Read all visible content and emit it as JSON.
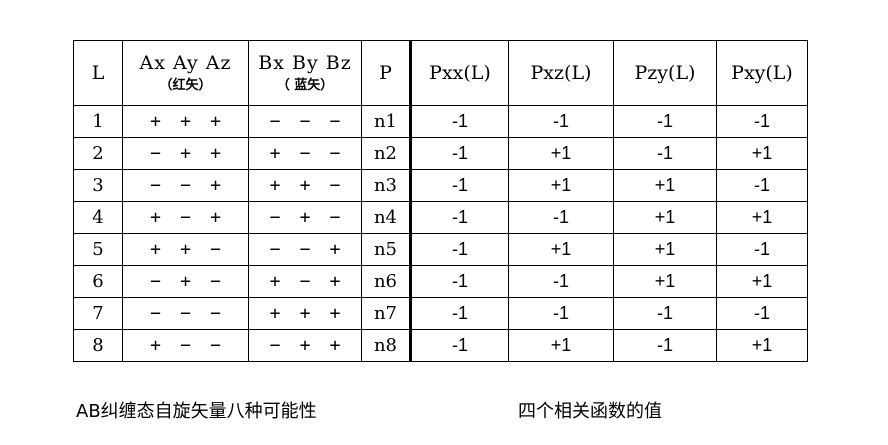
{
  "headers": {
    "L": "L",
    "A": "Ax Ay Az",
    "A_sub": "（红矢）",
    "B": "Bx By Bz",
    "B_sub": "（ 蓝矢）",
    "P": "P",
    "pxx": "Pxx(L)",
    "pxz": "Pxz(L)",
    "pzy": "Pzy(L)",
    "pxy": "Pxy(L)"
  },
  "rows": [
    {
      "l": "1",
      "a": [
        "+",
        "+",
        "+"
      ],
      "b": [
        "−",
        "−",
        "−"
      ],
      "p": "n1",
      "pxx": "-1",
      "pxz": "-1",
      "pzy": "-1",
      "pxy": "-1"
    },
    {
      "l": "2",
      "a": [
        "−",
        "+",
        "+"
      ],
      "b": [
        "+",
        "−",
        "−"
      ],
      "p": "n2",
      "pxx": "-1",
      "pxz": "+1",
      "pzy": "-1",
      "pxy": "+1"
    },
    {
      "l": "3",
      "a": [
        "−",
        "−",
        "+"
      ],
      "b": [
        "+",
        "+",
        "−"
      ],
      "p": "n3",
      "pxx": "-1",
      "pxz": "+1",
      "pzy": "+1",
      "pxy": "-1"
    },
    {
      "l": "4",
      "a": [
        "+",
        "−",
        "+"
      ],
      "b": [
        "−",
        "+",
        "−"
      ],
      "p": "n4",
      "pxx": "-1",
      "pxz": "-1",
      "pzy": "+1",
      "pxy": "+1"
    },
    {
      "l": "5",
      "a": [
        "+",
        "+",
        "−"
      ],
      "b": [
        "−",
        "−",
        "+"
      ],
      "p": "n5",
      "pxx": "-1",
      "pxz": "+1",
      "pzy": "+1",
      "pxy": "-1"
    },
    {
      "l": "6",
      "a": [
        "−",
        "+",
        "−"
      ],
      "b": [
        "+",
        "−",
        "+"
      ],
      "p": "n6",
      "pxx": "-1",
      "pxz": "-1",
      "pzy": "+1",
      "pxy": "+1"
    },
    {
      "l": "7",
      "a": [
        "−",
        "−",
        "−"
      ],
      "b": [
        "+",
        "+",
        "+"
      ],
      "p": "n7",
      "pxx": "-1",
      "pxz": "-1",
      "pzy": "-1",
      "pxy": "-1"
    },
    {
      "l": "8",
      "a": [
        "+",
        "−",
        "−"
      ],
      "b": [
        "−",
        "+",
        "+"
      ],
      "p": "n8",
      "pxx": "-1",
      "pxz": "+1",
      "pzy": "-1",
      "pxy": "+1"
    }
  ],
  "captions": {
    "left": "AB纠缠态自旋矢量八种可能性",
    "right": "四个相关函数的值"
  }
}
